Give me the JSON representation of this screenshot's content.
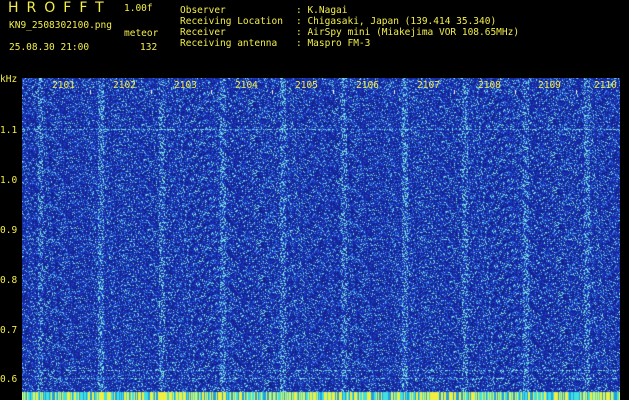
{
  "header": {
    "title": "HROFFT",
    "version": "1.00f",
    "filename": "KN9_2508302100.png",
    "meteor_label": "meteor",
    "datetime": "25.08.30 21:00",
    "meteor_count": "132",
    "info": [
      {
        "label": "Observer",
        "value": ": K.Nagai"
      },
      {
        "label": "Receiving Location",
        "value": ": Chigasaki, Japan (139.414 35.340)"
      },
      {
        "label": "Receiver",
        "value": ": AirSpy mini (Miakejima VOR 108.65MHz)"
      },
      {
        "label": "Receiving antenna",
        "value": ": Maspro FM-3"
      }
    ]
  },
  "spectrogram": {
    "y_unit": "kHz",
    "y_ticks": [
      "1.1",
      "1.0",
      "0.9",
      "0.8",
      "0.7",
      "0.6"
    ],
    "x_ticks": [
      "2101",
      "2102",
      "2103",
      "2104",
      "2105",
      "2106",
      "2107",
      "2108",
      "2109",
      "2110"
    ],
    "colors": {
      "background": "#14208c",
      "noise_low": "#1e3cc8",
      "noise_mid": "#3a8ee0",
      "noise_high": "#7ee8e0",
      "label": "#f2ee4a",
      "bottom_strip": "#f0f040"
    }
  }
}
